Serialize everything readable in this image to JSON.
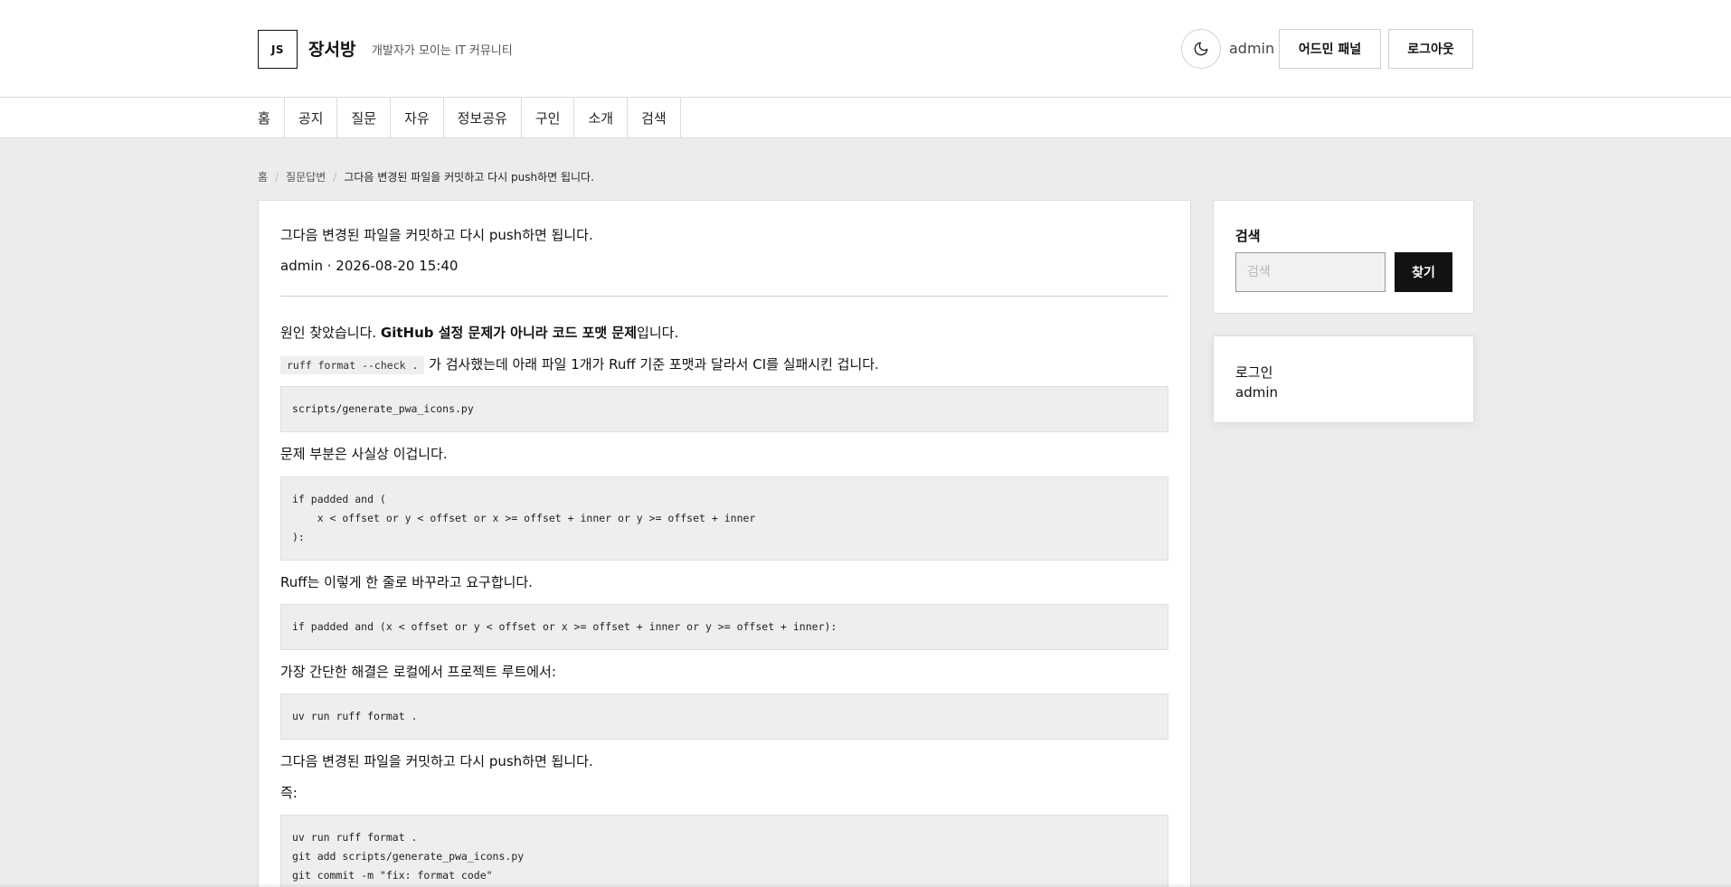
{
  "header": {
    "logo_text": "JS",
    "site_name": "장서방",
    "tagline": "개발자가 모이는 IT 커뮤니티",
    "username": "admin",
    "admin_button": "어드민 패널",
    "logout_button": "로그아웃"
  },
  "nav": {
    "items": [
      {
        "label": "홈"
      },
      {
        "label": "공지"
      },
      {
        "label": "질문"
      },
      {
        "label": "자유"
      },
      {
        "label": "정보공유"
      },
      {
        "label": "구인"
      },
      {
        "label": "소개"
      },
      {
        "label": "검색"
      }
    ]
  },
  "breadcrumb": {
    "home": "홈",
    "board": "질문답변",
    "current": "그다음 변경된 파일을 커밋하고 다시 push하면 됩니다."
  },
  "post": {
    "title": "그다음 변경된 파일을 커밋하고 다시 push하면 됩니다.",
    "meta": "admin · 2026-08-20 15:40",
    "p1_prefix": "원인 찾았습니다. ",
    "p1_bold": "GitHub 설정 문제가 아니라 코드 포맷 문제",
    "p1_suffix": "입니다.",
    "p2_code": "ruff format --check .",
    "p2_text": " 가 검사했는데 아래 파일 1개가 Ruff 기준 포맷과 달라서 CI를 실패시킨 겁니다.",
    "code1": "scripts/generate_pwa_icons.py",
    "p3": "문제 부분은 사실상 이겁니다.",
    "code2": "if padded and (\n    x < offset or y < offset or x >= offset + inner or y >= offset + inner\n):",
    "p4": "Ruff는 이렇게 한 줄로 바꾸라고 요구합니다.",
    "code3": "if padded and (x < offset or y < offset or x >= offset + inner or y >= offset + inner):",
    "p5": "가장 간단한 해결은 로컬에서 프로젝트 루트에서:",
    "code4": "uv run ruff format .",
    "p6": "그다음 변경된 파일을 커밋하고 다시 push하면 됩니다.",
    "p7": "즉:",
    "code5": "uv run ruff format .\ngit add scripts/generate_pwa_icons.py\ngit commit -m \"fix: format code\"\ngit push"
  },
  "sidebar": {
    "search_title": "검색",
    "search_placeholder": "검색",
    "search_button": "찾기",
    "login_title": "로그인",
    "login_user": "admin"
  }
}
